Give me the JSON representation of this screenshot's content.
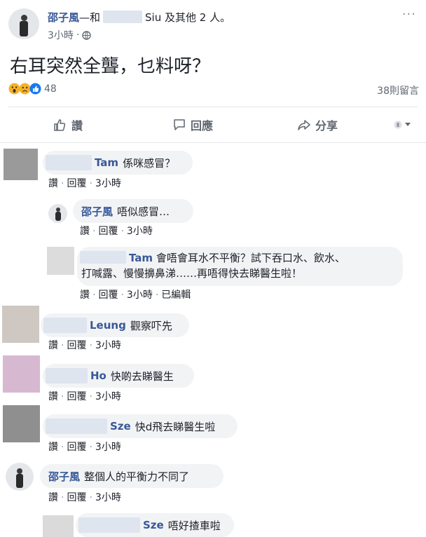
{
  "post": {
    "author": "邵子風",
    "with_prefix": "—和",
    "with_suffix": "Siu 及其他 2 人。",
    "time": "3小時",
    "dot": "·",
    "text": "右耳突然全聾，乜料呀？",
    "reaction_count": "48",
    "comment_count": "38則留言",
    "more": "···"
  },
  "action_bar": {
    "like": "讚",
    "comment": "回應",
    "share": "分享"
  },
  "comment_actions": {
    "like": "讚",
    "reply": "回覆",
    "edited": "已編輯",
    "sep": "·"
  },
  "comments": [
    {
      "name": "Tam",
      "text": "係咪感冒？",
      "time": "3小時",
      "avatar_color": "#9a9a9a"
    },
    {
      "name": "邵子風",
      "text": "唔似感冒…",
      "time": "3小時"
    },
    {
      "name": "Tam",
      "text_line1": "會唔會耳水不平衡？試下吞口水、飲水、",
      "text_line2": "打喊露、慢慢擤鼻涕……再唔得快去睇醫生啦！",
      "time": "3小時",
      "avatar_color": "#dcdcdc"
    },
    {
      "name": "Leung",
      "text": "觀察吓先",
      "time": "3小時",
      "avatar_color": "#cfc7c1"
    },
    {
      "name": "Ho",
      "text": "快啲去睇醫生",
      "time": "3小時",
      "avatar_color": "#d7b8d1"
    },
    {
      "name": "Sze",
      "text": "快d飛去睇醫生啦",
      "time": "3小時",
      "avatar_color": "#8f8f8f"
    },
    {
      "name": "邵子風",
      "text": "整個人的平衡力不同了",
      "time": "3小時"
    },
    {
      "name": "Sze",
      "text": "唔好揸車啦",
      "avatar_color": "#dadada"
    }
  ],
  "colors": {
    "link": "#385898",
    "bubble": "#f2f3f5",
    "like_blue": "#1877f2",
    "haha_yellow": "#f7b125"
  }
}
